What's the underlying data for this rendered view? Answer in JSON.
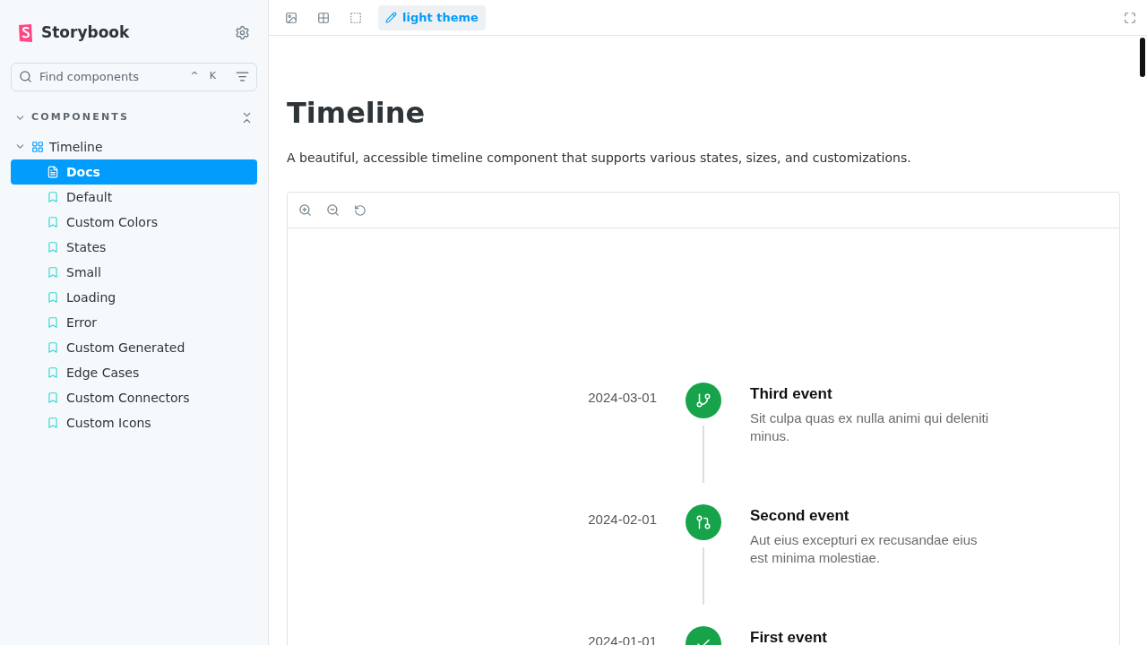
{
  "brand": {
    "name": "Storybook"
  },
  "search": {
    "placeholder": "Find components",
    "shortcut_keys": [
      "^",
      "K"
    ]
  },
  "sidebar": {
    "section": {
      "label": "COMPONENTS",
      "expanded": true
    },
    "tree": [
      {
        "label": "Timeline",
        "kind": "component",
        "expanded": true,
        "children": [
          {
            "label": "Docs",
            "kind": "docs",
            "selected": true
          },
          {
            "label": "Default",
            "kind": "story",
            "selected": false
          },
          {
            "label": "Custom Colors",
            "kind": "story",
            "selected": false
          },
          {
            "label": "States",
            "kind": "story",
            "selected": false
          },
          {
            "label": "Small",
            "kind": "story",
            "selected": false
          },
          {
            "label": "Loading",
            "kind": "story",
            "selected": false
          },
          {
            "label": "Error",
            "kind": "story",
            "selected": false
          },
          {
            "label": "Custom Generated",
            "kind": "story",
            "selected": false
          },
          {
            "label": "Edge Cases",
            "kind": "story",
            "selected": false
          },
          {
            "label": "Custom Connectors",
            "kind": "story",
            "selected": false
          },
          {
            "label": "Custom Icons",
            "kind": "story",
            "selected": false
          }
        ]
      }
    ]
  },
  "toolbar": {
    "theme_button": "light theme"
  },
  "docs": {
    "title": "Timeline",
    "description": "A beautiful, accessible timeline component that supports various states, sizes, and customizations.",
    "events": [
      {
        "date": "2024-03-01",
        "title": "Third event",
        "description": "Sit culpa quas ex nulla animi qui deleniti minus.",
        "kind": "branch",
        "color": "#16a34a"
      },
      {
        "date": "2024-02-01",
        "title": "Second event",
        "description": "Aut eius excepturi ex recusandae eius est minima molestiae.",
        "kind": "merge",
        "color": "#16a34a"
      },
      {
        "date": "2024-01-01",
        "title": "First event",
        "kind": "check",
        "color": "#16a34a"
      }
    ]
  }
}
